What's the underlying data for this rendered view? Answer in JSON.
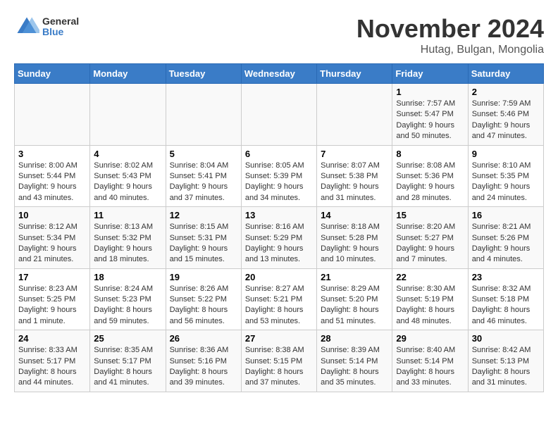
{
  "header": {
    "logo_general": "General",
    "logo_blue": "Blue",
    "month_year": "November 2024",
    "location": "Hutag, Bulgan, Mongolia"
  },
  "weekdays": [
    "Sunday",
    "Monday",
    "Tuesday",
    "Wednesday",
    "Thursday",
    "Friday",
    "Saturday"
  ],
  "weeks": [
    [
      {
        "day": "",
        "info": ""
      },
      {
        "day": "",
        "info": ""
      },
      {
        "day": "",
        "info": ""
      },
      {
        "day": "",
        "info": ""
      },
      {
        "day": "",
        "info": ""
      },
      {
        "day": "1",
        "info": "Sunrise: 7:57 AM\nSunset: 5:47 PM\nDaylight: 9 hours and 50 minutes."
      },
      {
        "day": "2",
        "info": "Sunrise: 7:59 AM\nSunset: 5:46 PM\nDaylight: 9 hours and 47 minutes."
      }
    ],
    [
      {
        "day": "3",
        "info": "Sunrise: 8:00 AM\nSunset: 5:44 PM\nDaylight: 9 hours and 43 minutes."
      },
      {
        "day": "4",
        "info": "Sunrise: 8:02 AM\nSunset: 5:43 PM\nDaylight: 9 hours and 40 minutes."
      },
      {
        "day": "5",
        "info": "Sunrise: 8:04 AM\nSunset: 5:41 PM\nDaylight: 9 hours and 37 minutes."
      },
      {
        "day": "6",
        "info": "Sunrise: 8:05 AM\nSunset: 5:39 PM\nDaylight: 9 hours and 34 minutes."
      },
      {
        "day": "7",
        "info": "Sunrise: 8:07 AM\nSunset: 5:38 PM\nDaylight: 9 hours and 31 minutes."
      },
      {
        "day": "8",
        "info": "Sunrise: 8:08 AM\nSunset: 5:36 PM\nDaylight: 9 hours and 28 minutes."
      },
      {
        "day": "9",
        "info": "Sunrise: 8:10 AM\nSunset: 5:35 PM\nDaylight: 9 hours and 24 minutes."
      }
    ],
    [
      {
        "day": "10",
        "info": "Sunrise: 8:12 AM\nSunset: 5:34 PM\nDaylight: 9 hours and 21 minutes."
      },
      {
        "day": "11",
        "info": "Sunrise: 8:13 AM\nSunset: 5:32 PM\nDaylight: 9 hours and 18 minutes."
      },
      {
        "day": "12",
        "info": "Sunrise: 8:15 AM\nSunset: 5:31 PM\nDaylight: 9 hours and 15 minutes."
      },
      {
        "day": "13",
        "info": "Sunrise: 8:16 AM\nSunset: 5:29 PM\nDaylight: 9 hours and 13 minutes."
      },
      {
        "day": "14",
        "info": "Sunrise: 8:18 AM\nSunset: 5:28 PM\nDaylight: 9 hours and 10 minutes."
      },
      {
        "day": "15",
        "info": "Sunrise: 8:20 AM\nSunset: 5:27 PM\nDaylight: 9 hours and 7 minutes."
      },
      {
        "day": "16",
        "info": "Sunrise: 8:21 AM\nSunset: 5:26 PM\nDaylight: 9 hours and 4 minutes."
      }
    ],
    [
      {
        "day": "17",
        "info": "Sunrise: 8:23 AM\nSunset: 5:25 PM\nDaylight: 9 hours and 1 minute."
      },
      {
        "day": "18",
        "info": "Sunrise: 8:24 AM\nSunset: 5:23 PM\nDaylight: 8 hours and 59 minutes."
      },
      {
        "day": "19",
        "info": "Sunrise: 8:26 AM\nSunset: 5:22 PM\nDaylight: 8 hours and 56 minutes."
      },
      {
        "day": "20",
        "info": "Sunrise: 8:27 AM\nSunset: 5:21 PM\nDaylight: 8 hours and 53 minutes."
      },
      {
        "day": "21",
        "info": "Sunrise: 8:29 AM\nSunset: 5:20 PM\nDaylight: 8 hours and 51 minutes."
      },
      {
        "day": "22",
        "info": "Sunrise: 8:30 AM\nSunset: 5:19 PM\nDaylight: 8 hours and 48 minutes."
      },
      {
        "day": "23",
        "info": "Sunrise: 8:32 AM\nSunset: 5:18 PM\nDaylight: 8 hours and 46 minutes."
      }
    ],
    [
      {
        "day": "24",
        "info": "Sunrise: 8:33 AM\nSunset: 5:17 PM\nDaylight: 8 hours and 44 minutes."
      },
      {
        "day": "25",
        "info": "Sunrise: 8:35 AM\nSunset: 5:17 PM\nDaylight: 8 hours and 41 minutes."
      },
      {
        "day": "26",
        "info": "Sunrise: 8:36 AM\nSunset: 5:16 PM\nDaylight: 8 hours and 39 minutes."
      },
      {
        "day": "27",
        "info": "Sunrise: 8:38 AM\nSunset: 5:15 PM\nDaylight: 8 hours and 37 minutes."
      },
      {
        "day": "28",
        "info": "Sunrise: 8:39 AM\nSunset: 5:14 PM\nDaylight: 8 hours and 35 minutes."
      },
      {
        "day": "29",
        "info": "Sunrise: 8:40 AM\nSunset: 5:14 PM\nDaylight: 8 hours and 33 minutes."
      },
      {
        "day": "30",
        "info": "Sunrise: 8:42 AM\nSunset: 5:13 PM\nDaylight: 8 hours and 31 minutes."
      }
    ]
  ]
}
